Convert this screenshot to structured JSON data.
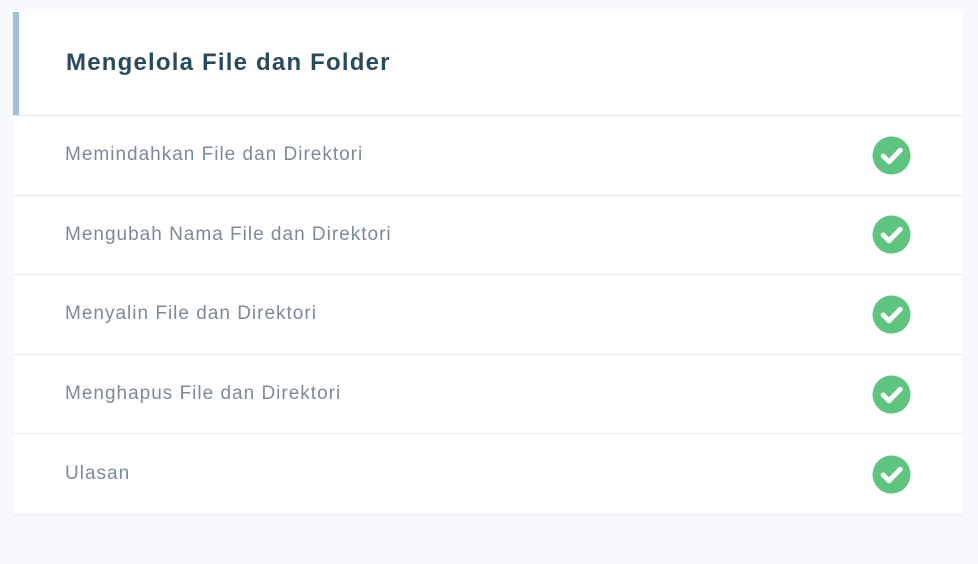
{
  "module": {
    "title": "Mengelola File dan Folder"
  },
  "lessons": [
    {
      "label": "Memindahkan File dan Direktori",
      "status": "completed",
      "icon": "check-circle-icon"
    },
    {
      "label": "Mengubah Nama File dan Direktori",
      "status": "completed",
      "icon": "check-circle-icon"
    },
    {
      "label": "Menyalin File dan Direktori",
      "status": "completed",
      "icon": "check-circle-icon"
    },
    {
      "label": "Menghapus File dan Direktori",
      "status": "completed",
      "icon": "check-circle-icon"
    },
    {
      "label": "Ulasan",
      "status": "completed",
      "icon": "check-circle-icon"
    }
  ],
  "colors": {
    "accent_bar": "#9cc3d5",
    "title": "#2c4a5e",
    "label": "#7d8a97",
    "check": "#5ec47f",
    "background": "#f8f9fc"
  }
}
